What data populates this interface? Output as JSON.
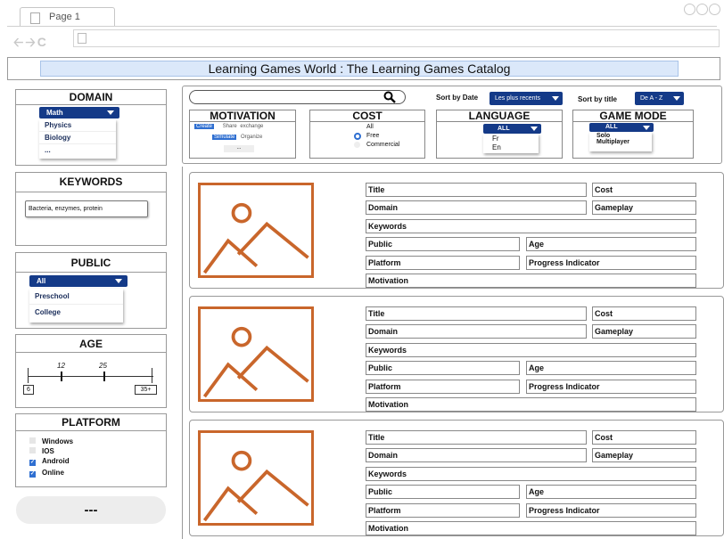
{
  "browser": {
    "tab_label": "Page 1",
    "nav_icons": [
      "back-arrow-icon",
      "forward-arrow-icon",
      "reload-icon"
    ]
  },
  "site": {
    "title": "Learning Games World : The Learning Games Catalog"
  },
  "sidebar": {
    "domain": {
      "title": "DOMAIN",
      "selected": "Math",
      "options": [
        "Physics",
        "Biology",
        "..."
      ]
    },
    "keywords": {
      "title": "KEYWORDS",
      "value": "Bacteria, enzymes, protein"
    },
    "public": {
      "title": "PUBLIC",
      "selected": "All",
      "options": [
        "Preschool",
        "College"
      ]
    },
    "age": {
      "title": "AGE",
      "range_min": "6",
      "range_max": "35+",
      "handle_low": "12",
      "handle_high": "25"
    },
    "platform": {
      "title": "PLATFORM",
      "options": [
        {
          "label": "Windows",
          "checked": false
        },
        {
          "label": "IOS",
          "checked": false
        },
        {
          "label": "Android",
          "checked": true
        },
        {
          "label": "Online",
          "checked": true
        }
      ]
    },
    "more_button": "---"
  },
  "filters": {
    "search_placeholder": "",
    "sort_by_date_label": "Sort by Date",
    "sort_by_date_value": "Les plus recents",
    "sort_by_title_label": "Sort by title",
    "sort_by_title_value": "De A - Z",
    "motivation": {
      "title": "MOTIVATION",
      "tags": [
        "Create",
        "Share",
        "exchange",
        "Simulate",
        "Organize",
        "..."
      ]
    },
    "cost": {
      "title": "COST",
      "options": [
        "All",
        "Free",
        "Commercial"
      ],
      "selected": "Free"
    },
    "language": {
      "title": "LANGUAGE",
      "selected": "ALL",
      "options": [
        "Fr",
        "En"
      ]
    },
    "game_mode": {
      "title": "GAME MODE",
      "selected": "ALL",
      "options": [
        "Solo",
        "Multiplayer"
      ]
    }
  },
  "results": [
    {
      "title": "Title",
      "cost": "Cost",
      "domain": "Domain",
      "gameplay": "Gameplay",
      "keywords": "Keywords",
      "public": "Public",
      "age": "Age",
      "platform": "Platform",
      "progress": "Progress Indicator",
      "motivation": "Motivation"
    },
    {
      "title": "Title",
      "cost": "Cost",
      "domain": "Domain",
      "gameplay": "Gameplay",
      "keywords": "Keywords",
      "public": "Public",
      "age": "Age",
      "platform": "Platform",
      "progress": "Progress Indicator",
      "motivation": "Motivation"
    },
    {
      "title": "Title",
      "cost": "Cost",
      "domain": "Domain",
      "gameplay": "Gameplay",
      "keywords": "Keywords",
      "public": "Public",
      "age": "Age",
      "platform": "Platform",
      "progress": "Progress Indicator",
      "motivation": "Motivation"
    }
  ],
  "colors": {
    "select_bg": "#143a88",
    "header_bg": "#dbe8fa",
    "image_placeholder": "#c9662b",
    "checkbox": "#2f6fd1"
  }
}
